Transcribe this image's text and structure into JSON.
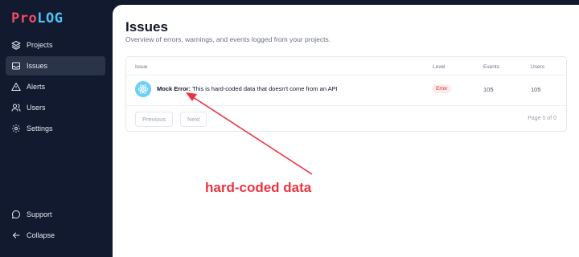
{
  "sidebar": {
    "logo_part1": "Pro",
    "logo_part2": "LOG",
    "items": [
      {
        "label": "Projects",
        "icon": "layers-icon"
      },
      {
        "label": "Issues",
        "icon": "inbox-icon",
        "active": true
      },
      {
        "label": "Alerts",
        "icon": "warning-icon"
      },
      {
        "label": "Users",
        "icon": "users-icon"
      },
      {
        "label": "Settings",
        "icon": "gear-icon"
      }
    ],
    "bottom_items": [
      {
        "label": "Support",
        "icon": "chat-icon"
      },
      {
        "label": "Collapse",
        "icon": "arrow-left-icon"
      }
    ]
  },
  "header": {
    "title": "Issues",
    "subtitle": "Overview of errors, warnings, and events logged from your projects."
  },
  "table": {
    "columns": [
      "Issue",
      "Level",
      "Events",
      "Users"
    ],
    "rows": [
      {
        "name": "Mock Error:",
        "message": "This is hard-coded data that doesn't come from an API",
        "level": "Error",
        "events": "105",
        "users": "105",
        "icon": "react-icon"
      }
    ],
    "prev_label": "Previous",
    "next_label": "Next",
    "page_info": "Page 0 of 0"
  },
  "annotation": {
    "text": "hard-coded data",
    "color": "#ec3340"
  },
  "colors": {
    "sidebar_bg": "#111a2e",
    "active_bg": "#2a3448",
    "accent_red": "#ef4b6b",
    "accent_blue": "#4fc3f7"
  }
}
